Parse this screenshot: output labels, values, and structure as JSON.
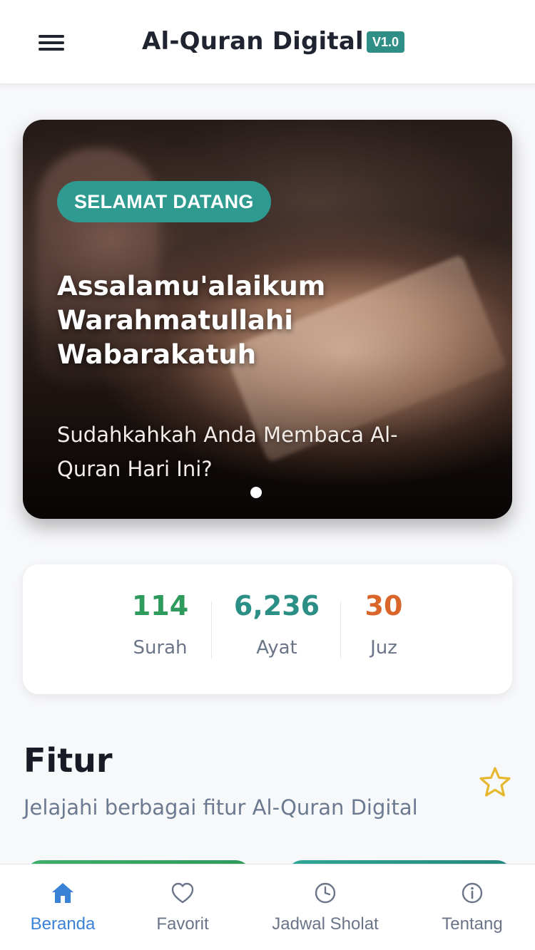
{
  "header": {
    "title": "Al-Quran Digital",
    "version": "V1.0",
    "menu_icon": "hamburger-menu-icon"
  },
  "hero": {
    "badge": "SELAMAT DATANG",
    "greeting": "Assalamu'alaikum Warahmatullahi Wabarakatuh",
    "question": "Sudahkahkah Anda Membaca Al-Quran Hari Ini?",
    "carousel_dots": 1,
    "active_dot": 1
  },
  "stats": [
    {
      "value": "114",
      "label": "Surah",
      "color": "#2e9a5c"
    },
    {
      "value": "6,236",
      "label": "Ayat",
      "color": "#2b8f86"
    },
    {
      "value": "30",
      "label": "Juz",
      "color": "#d9652a"
    }
  ],
  "features": {
    "title": "Fitur",
    "subtitle": "Jelajahi berbagai fitur Al-Quran Digital",
    "icon": "star-icon",
    "card_colors": [
      "#3aa866",
      "#2a9a8e"
    ]
  },
  "bottom_nav": {
    "items": [
      {
        "label": "Beranda",
        "icon": "home-icon",
        "active": true
      },
      {
        "label": "Favorit",
        "icon": "heart-icon",
        "active": false
      },
      {
        "label": "Jadwal Sholat",
        "icon": "clock-icon",
        "active": false
      },
      {
        "label": "Tentang",
        "icon": "info-icon",
        "active": false
      }
    ],
    "active_color": "#3a82d6",
    "inactive_color": "#6b7588"
  }
}
